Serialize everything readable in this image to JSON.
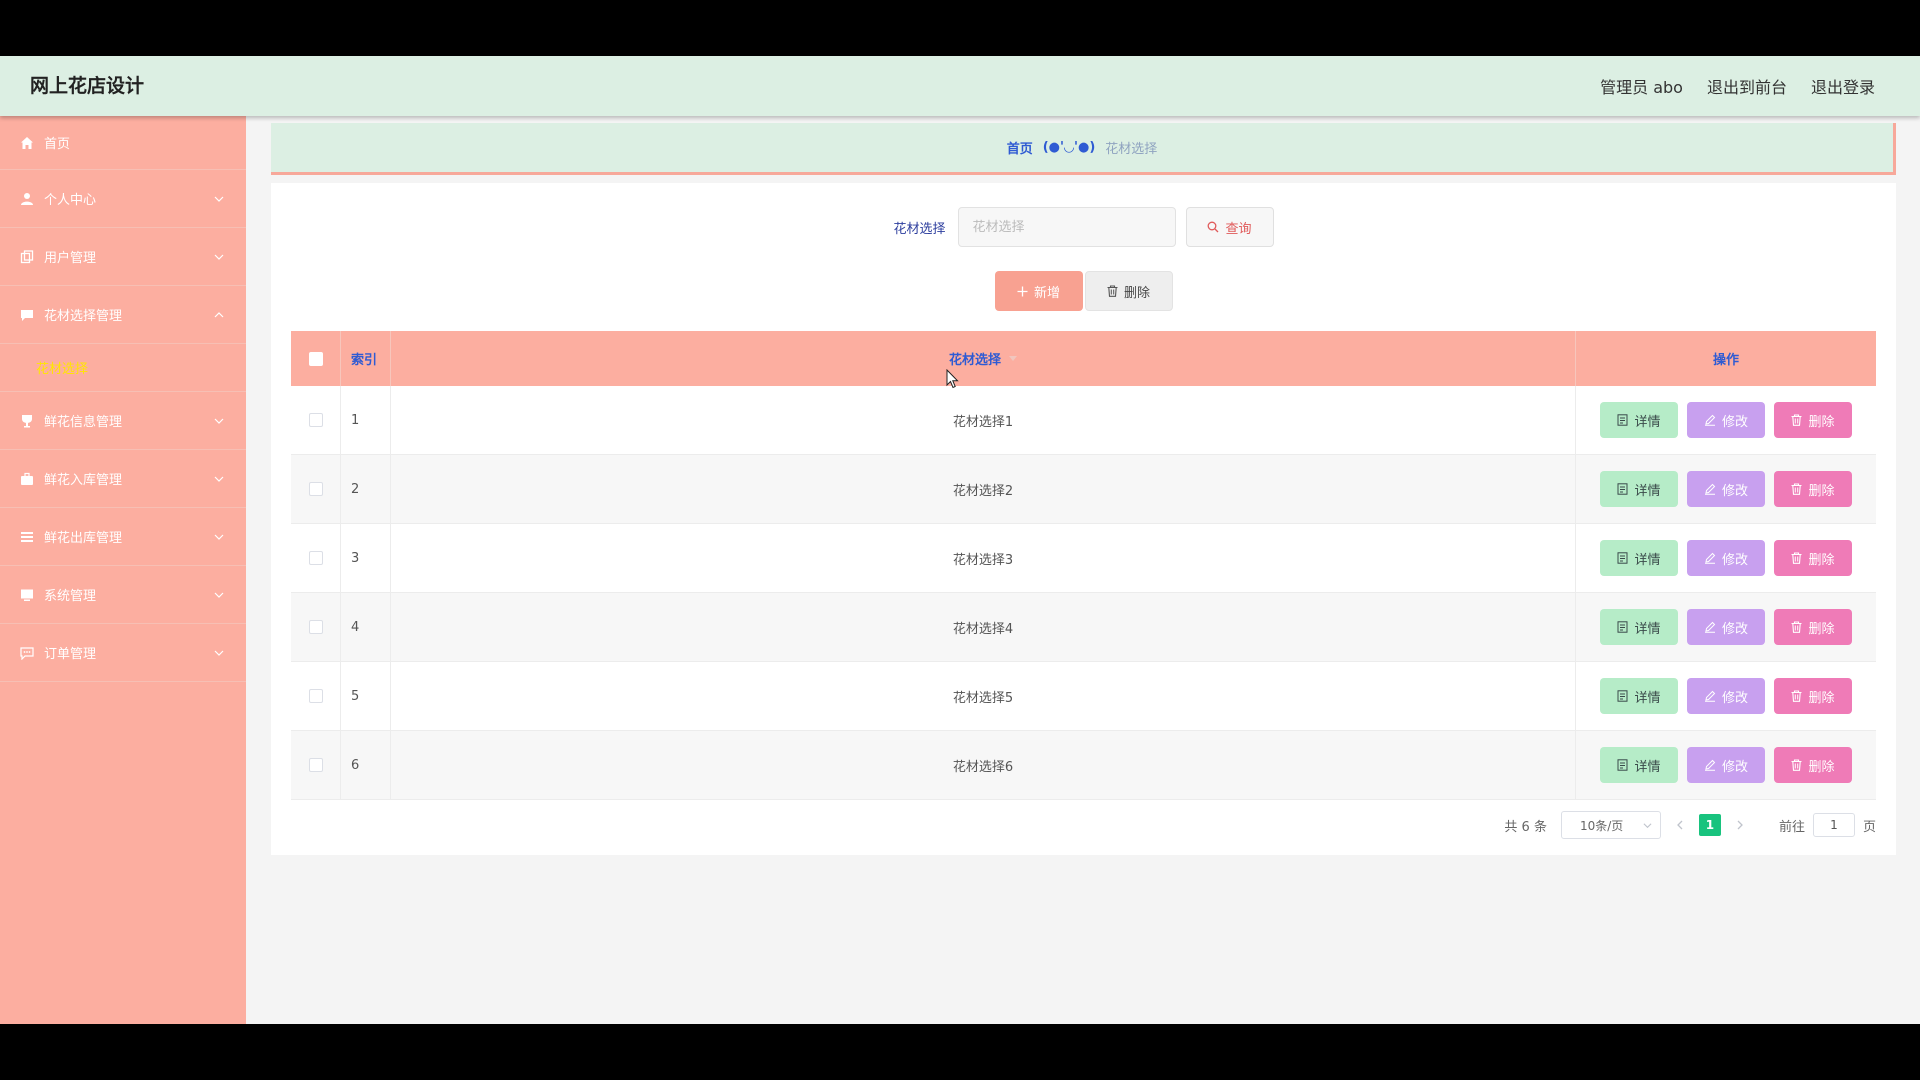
{
  "app": {
    "title": "网上花店设计"
  },
  "topbar": {
    "links": [
      "管理员 abo",
      "退出到前台",
      "退出登录"
    ]
  },
  "sidebar": {
    "items": [
      {
        "label": "首页",
        "icon": "home-icon"
      },
      {
        "label": "个人中心",
        "icon": "user-icon"
      },
      {
        "label": "用户管理",
        "icon": "copy-icon"
      },
      {
        "label": "花材选择管理",
        "icon": "chat-icon"
      },
      {
        "label": "鲜花信息管理",
        "icon": "trophy-icon"
      },
      {
        "label": "鲜花入库管理",
        "icon": "briefcase-icon"
      },
      {
        "label": "鲜花出库管理",
        "icon": "menu-icon"
      },
      {
        "label": "系统管理",
        "icon": "monitor-icon"
      },
      {
        "label": "订单管理",
        "icon": "message-icon"
      }
    ],
    "submenu_active": "花材选择"
  },
  "breadcrumb": {
    "home": "首页",
    "face": "(●'◡'●)",
    "current": "花材选择"
  },
  "search": {
    "label": "花材选择",
    "placeholder": "花材选择",
    "query_button": "查询"
  },
  "actions": {
    "add": "新增",
    "delete": "删除"
  },
  "table": {
    "columns": {
      "index": "索引",
      "name": "花材选择",
      "ops": "操作"
    },
    "rows": [
      {
        "index": "1",
        "name": "花材选择1"
      },
      {
        "index": "2",
        "name": "花材选择2"
      },
      {
        "index": "3",
        "name": "花材选择3"
      },
      {
        "index": "4",
        "name": "花材选择4"
      },
      {
        "index": "5",
        "name": "花材选择5"
      },
      {
        "index": "6",
        "name": "花材选择6"
      }
    ],
    "row_buttons": {
      "detail": "详情",
      "edit": "修改",
      "delete": "删除"
    }
  },
  "pagination": {
    "total": "共 6 条",
    "page_size": "10条/页",
    "current_page": "1",
    "goto_label": "前往",
    "goto_value": "1",
    "goto_unit": "页"
  },
  "colors": {
    "topbar": "#dcefe3",
    "sidebar": "#fcaea0",
    "table_header": "#fcaea0",
    "accent_blue": "#2f5bd3",
    "detail_btn": "#b6ecc8",
    "edit_btn": "#c8a0ef",
    "delete_btn": "#ef7bb7",
    "active_page": "#18c37e"
  }
}
